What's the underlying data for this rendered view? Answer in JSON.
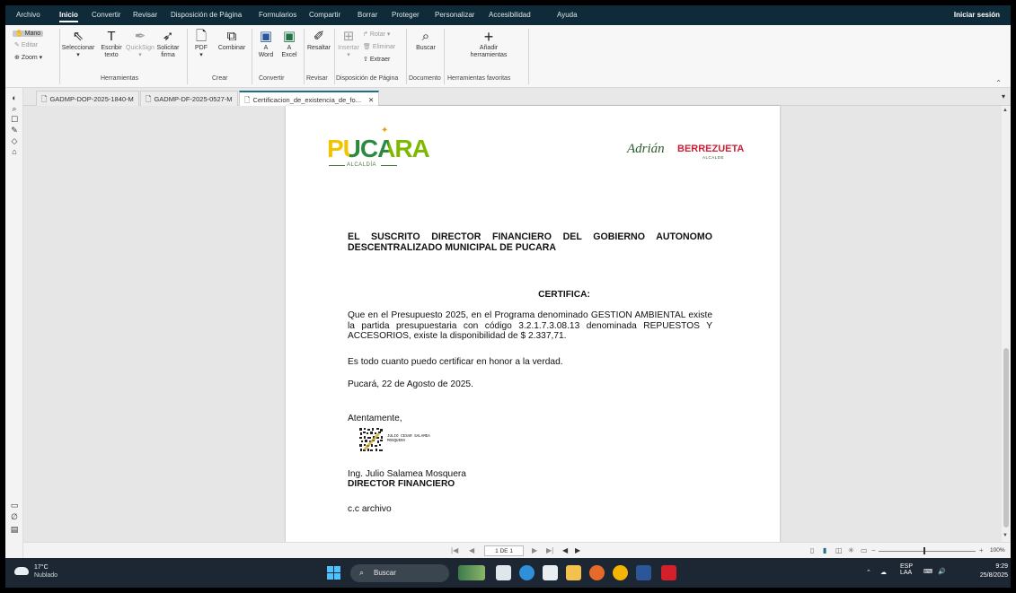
{
  "menubar": {
    "items": [
      "Archivo",
      "Inicio",
      "Convertir",
      "Revisar",
      "Disposición de Página",
      "Formularios",
      "Compartir",
      "Borrar",
      "Proteger",
      "Personalizar",
      "Accesibilidad",
      "Ayuda"
    ],
    "active": "Inicio",
    "signin": "Iniciar sesión"
  },
  "ribbon": {
    "mano": "Mano",
    "editar": "Editar",
    "zoom": "Zoom ▾",
    "seleccionar": "Seleccionar",
    "escribir_1": "Escribir",
    "escribir_2": "texto",
    "quicksign": "QuickSign",
    "solicitar_1": "Solicitar",
    "solicitar_2": "firma",
    "herramientas": "Herramientas",
    "pdf": "PDF",
    "combinar": "Combinar",
    "crear": "Crear",
    "a_word_1": "A",
    "a_word_2": "Word",
    "a_excel_1": "A",
    "a_excel_2": "Excel",
    "convertir": "Convertir",
    "resaltar": "Resaltar",
    "revisar": "Revisar",
    "insertar": "Insertar",
    "rotar": "Rotar ▾",
    "eliminar": "Eliminar",
    "extraer": "Extraer",
    "disposicion": "Disposición de Página",
    "buscar": "Buscar",
    "documento": "Documento",
    "anadir_1": "Añadir",
    "anadir_2": "herramientas",
    "favoritas": "Herramientas favoritas"
  },
  "tabs": [
    {
      "label": "GADMP-DOP-2025-1840-M"
    },
    {
      "label": "GADMP-DF-2025-0527-M"
    },
    {
      "label": "Certificacion_de_existencia_de_fo...",
      "active": true
    }
  ],
  "document": {
    "logo_text": "PUCARA",
    "logo_alcaldia": "ALCALDÍA",
    "mayor_first": "Adrián",
    "mayor_last": "BERREZUETA",
    "mayor_role": "ALCALDE",
    "heading": "EL SUSCRITO DIRECTOR FINANCIERO DEL GOBIERNO AUTONOMO DESCENTRALIZADO MUNICIPAL DE PUCARA",
    "certifica": "CERTIFICA:",
    "paragraph_1": "Que en el Presupuesto 2025, en el Programa denominado GESTION AMBIENTAL existe la partida presupuestaria con código 3.2.1.7.3.08.13 denominada REPUESTOS Y ACCESORIOS, existe la disponibilidad de $ 2.337,71.",
    "paragraph_2": "Es todo cuanto puedo certificar en honor a la verdad.",
    "place_date": "Pucará, 22 de Agosto de 2025.",
    "closing": "Atentamente,",
    "signature_name_1": "JULIO CESAR SALAMEA",
    "signature_name_2": "MOSQUERA",
    "signer_name": "Ing. Julio Salamea Mosquera",
    "signer_title": "DIRECTOR FINANCIERO",
    "cc": "c.c archivo"
  },
  "statusbar": {
    "page_indicator": "1 DE 1",
    "zoom": "100%",
    "zoom_level": 0.46
  },
  "taskbar": {
    "temperature": "17°C",
    "weather": "Nublado",
    "search_placeholder": "Buscar",
    "lang_1": "ESP",
    "lang_2": "LAA",
    "time": "9:29",
    "date": "25/8/2025"
  },
  "colors": {
    "menubar_bg": "#0f2a38",
    "accent": "#1e6e8a",
    "mayor_red": "#c8203a",
    "mayor_green": "#2b5a2b"
  }
}
